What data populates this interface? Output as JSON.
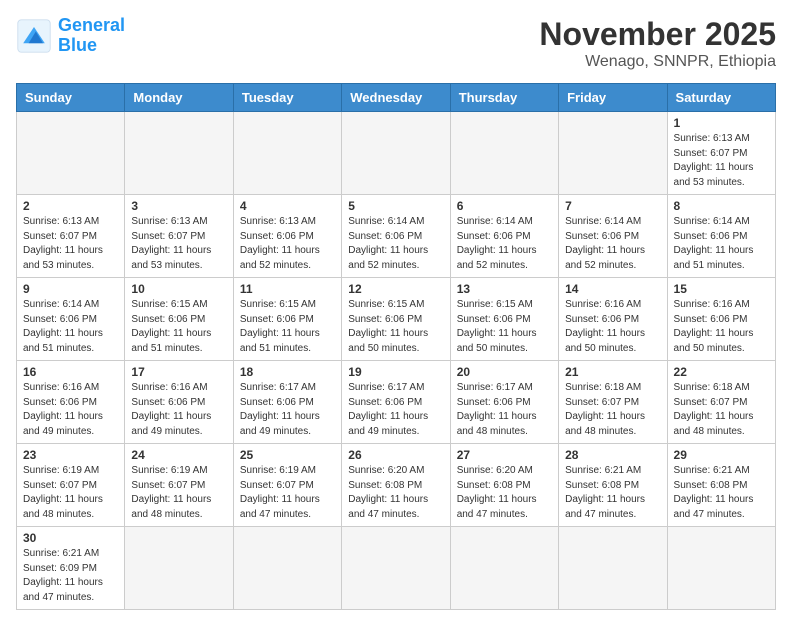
{
  "header": {
    "logo_general": "General",
    "logo_blue": "Blue",
    "title": "November 2025",
    "subtitle": "Wenago, SNNPR, Ethiopia"
  },
  "days": [
    "Sunday",
    "Monday",
    "Tuesday",
    "Wednesday",
    "Thursday",
    "Friday",
    "Saturday"
  ],
  "weeks": [
    [
      {
        "day": "",
        "empty": true,
        "content": ""
      },
      {
        "day": "",
        "empty": true,
        "content": ""
      },
      {
        "day": "",
        "empty": true,
        "content": ""
      },
      {
        "day": "",
        "empty": true,
        "content": ""
      },
      {
        "day": "",
        "empty": true,
        "content": ""
      },
      {
        "day": "",
        "empty": true,
        "content": ""
      },
      {
        "day": "1",
        "empty": false,
        "content": "Sunrise: 6:13 AM\nSunset: 6:07 PM\nDaylight: 11 hours\nand 53 minutes."
      }
    ],
    [
      {
        "day": "2",
        "empty": false,
        "content": "Sunrise: 6:13 AM\nSunset: 6:07 PM\nDaylight: 11 hours\nand 53 minutes."
      },
      {
        "day": "3",
        "empty": false,
        "content": "Sunrise: 6:13 AM\nSunset: 6:07 PM\nDaylight: 11 hours\nand 53 minutes."
      },
      {
        "day": "4",
        "empty": false,
        "content": "Sunrise: 6:13 AM\nSunset: 6:06 PM\nDaylight: 11 hours\nand 52 minutes."
      },
      {
        "day": "5",
        "empty": false,
        "content": "Sunrise: 6:14 AM\nSunset: 6:06 PM\nDaylight: 11 hours\nand 52 minutes."
      },
      {
        "day": "6",
        "empty": false,
        "content": "Sunrise: 6:14 AM\nSunset: 6:06 PM\nDaylight: 11 hours\nand 52 minutes."
      },
      {
        "day": "7",
        "empty": false,
        "content": "Sunrise: 6:14 AM\nSunset: 6:06 PM\nDaylight: 11 hours\nand 52 minutes."
      },
      {
        "day": "8",
        "empty": false,
        "content": "Sunrise: 6:14 AM\nSunset: 6:06 PM\nDaylight: 11 hours\nand 51 minutes."
      }
    ],
    [
      {
        "day": "9",
        "empty": false,
        "content": "Sunrise: 6:14 AM\nSunset: 6:06 PM\nDaylight: 11 hours\nand 51 minutes."
      },
      {
        "day": "10",
        "empty": false,
        "content": "Sunrise: 6:15 AM\nSunset: 6:06 PM\nDaylight: 11 hours\nand 51 minutes."
      },
      {
        "day": "11",
        "empty": false,
        "content": "Sunrise: 6:15 AM\nSunset: 6:06 PM\nDaylight: 11 hours\nand 51 minutes."
      },
      {
        "day": "12",
        "empty": false,
        "content": "Sunrise: 6:15 AM\nSunset: 6:06 PM\nDaylight: 11 hours\nand 50 minutes."
      },
      {
        "day": "13",
        "empty": false,
        "content": "Sunrise: 6:15 AM\nSunset: 6:06 PM\nDaylight: 11 hours\nand 50 minutes."
      },
      {
        "day": "14",
        "empty": false,
        "content": "Sunrise: 6:16 AM\nSunset: 6:06 PM\nDaylight: 11 hours\nand 50 minutes."
      },
      {
        "day": "15",
        "empty": false,
        "content": "Sunrise: 6:16 AM\nSunset: 6:06 PM\nDaylight: 11 hours\nand 50 minutes."
      }
    ],
    [
      {
        "day": "16",
        "empty": false,
        "content": "Sunrise: 6:16 AM\nSunset: 6:06 PM\nDaylight: 11 hours\nand 49 minutes."
      },
      {
        "day": "17",
        "empty": false,
        "content": "Sunrise: 6:16 AM\nSunset: 6:06 PM\nDaylight: 11 hours\nand 49 minutes."
      },
      {
        "day": "18",
        "empty": false,
        "content": "Sunrise: 6:17 AM\nSunset: 6:06 PM\nDaylight: 11 hours\nand 49 minutes."
      },
      {
        "day": "19",
        "empty": false,
        "content": "Sunrise: 6:17 AM\nSunset: 6:06 PM\nDaylight: 11 hours\nand 49 minutes."
      },
      {
        "day": "20",
        "empty": false,
        "content": "Sunrise: 6:17 AM\nSunset: 6:06 PM\nDaylight: 11 hours\nand 48 minutes."
      },
      {
        "day": "21",
        "empty": false,
        "content": "Sunrise: 6:18 AM\nSunset: 6:07 PM\nDaylight: 11 hours\nand 48 minutes."
      },
      {
        "day": "22",
        "empty": false,
        "content": "Sunrise: 6:18 AM\nSunset: 6:07 PM\nDaylight: 11 hours\nand 48 minutes."
      }
    ],
    [
      {
        "day": "23",
        "empty": false,
        "content": "Sunrise: 6:19 AM\nSunset: 6:07 PM\nDaylight: 11 hours\nand 48 minutes."
      },
      {
        "day": "24",
        "empty": false,
        "content": "Sunrise: 6:19 AM\nSunset: 6:07 PM\nDaylight: 11 hours\nand 48 minutes."
      },
      {
        "day": "25",
        "empty": false,
        "content": "Sunrise: 6:19 AM\nSunset: 6:07 PM\nDaylight: 11 hours\nand 47 minutes."
      },
      {
        "day": "26",
        "empty": false,
        "content": "Sunrise: 6:20 AM\nSunset: 6:08 PM\nDaylight: 11 hours\nand 47 minutes."
      },
      {
        "day": "27",
        "empty": false,
        "content": "Sunrise: 6:20 AM\nSunset: 6:08 PM\nDaylight: 11 hours\nand 47 minutes."
      },
      {
        "day": "28",
        "empty": false,
        "content": "Sunrise: 6:21 AM\nSunset: 6:08 PM\nDaylight: 11 hours\nand 47 minutes."
      },
      {
        "day": "29",
        "empty": false,
        "content": "Sunrise: 6:21 AM\nSunset: 6:08 PM\nDaylight: 11 hours\nand 47 minutes."
      }
    ],
    [
      {
        "day": "30",
        "empty": false,
        "content": "Sunrise: 6:21 AM\nSunset: 6:09 PM\nDaylight: 11 hours\nand 47 minutes."
      },
      {
        "day": "",
        "empty": true,
        "content": ""
      },
      {
        "day": "",
        "empty": true,
        "content": ""
      },
      {
        "day": "",
        "empty": true,
        "content": ""
      },
      {
        "day": "",
        "empty": true,
        "content": ""
      },
      {
        "day": "",
        "empty": true,
        "content": ""
      },
      {
        "day": "",
        "empty": true,
        "content": ""
      }
    ]
  ]
}
